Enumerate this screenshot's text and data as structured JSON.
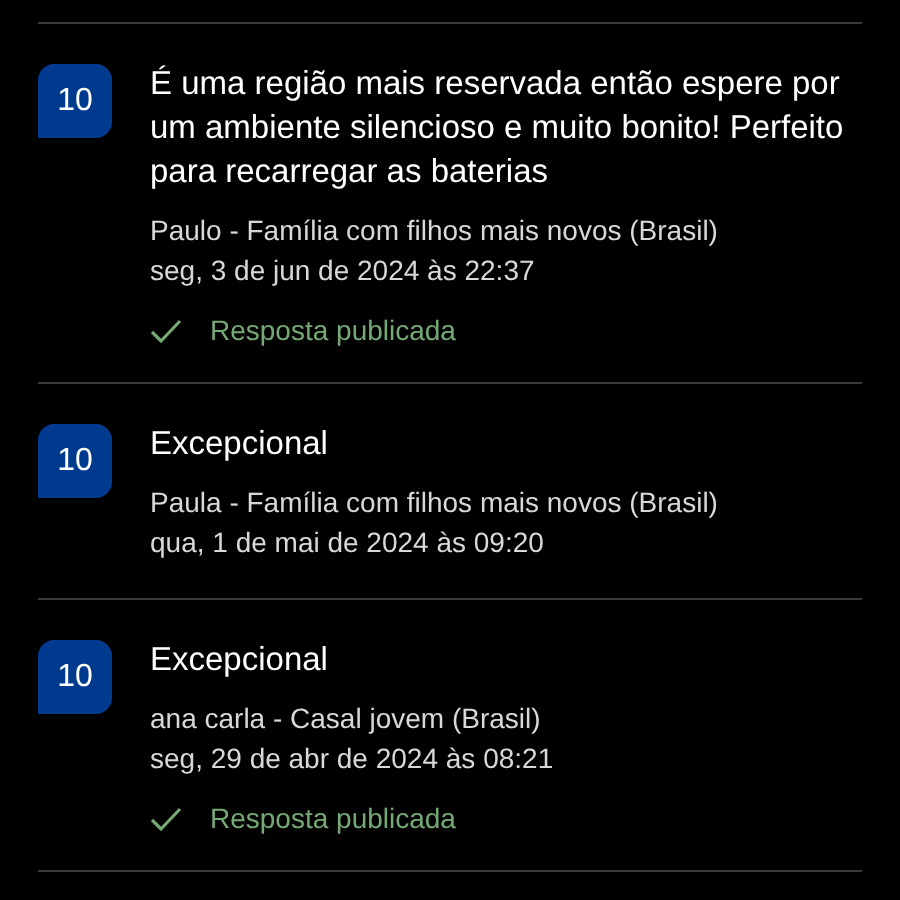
{
  "reviews": [
    {
      "score": "10",
      "title": "É uma região mais reservada então espere por um ambiente silencioso e muito bonito! Perfeito para recarregar as baterias",
      "author": "Paulo - Família com filhos mais novos (Brasil)",
      "date": "seg, 3 de jun de 2024 às 22:37",
      "reply": "Resposta publicada"
    },
    {
      "score": "10",
      "title": "Excepcional",
      "author": "Paula - Família com filhos mais novos (Brasil)",
      "date": "qua, 1 de mai de 2024 às 09:20"
    },
    {
      "score": "10",
      "title": "Excepcional",
      "author": "ana carla - Casal jovem (Brasil)",
      "date": "seg, 29 de abr de 2024 às 08:21",
      "reply": "Resposta publicada"
    }
  ]
}
